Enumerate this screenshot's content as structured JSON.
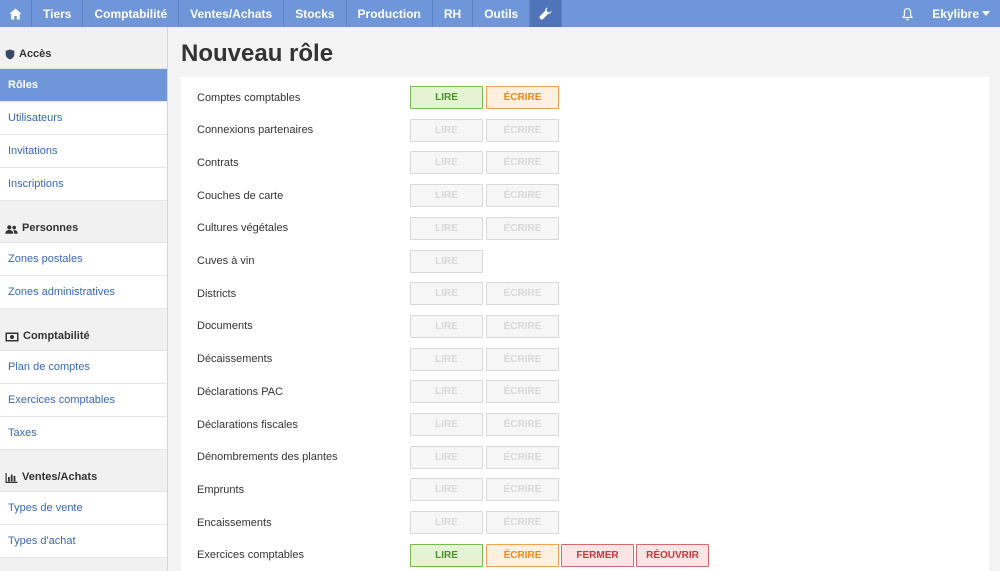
{
  "topbar": {
    "home_icon": "home-icon",
    "items": [
      "Tiers",
      "Comptabilité",
      "Ventes/Achats",
      "Stocks",
      "Production",
      "RH",
      "Outils"
    ],
    "settings_icon": "wrench-icon",
    "bell_icon": "bell-icon",
    "user": "Ekylibre"
  },
  "colors": {
    "accent": "#6f96d8",
    "read": "#77bb4a",
    "write": "#f0a24c",
    "danger": "#d66a6a"
  },
  "sidebar": {
    "sections": [
      {
        "title": "Accès",
        "icon": "shield-icon",
        "items": [
          {
            "label": "Rôles",
            "active": true
          },
          {
            "label": "Utilisateurs"
          },
          {
            "label": "Invitations"
          },
          {
            "label": "Inscriptions"
          }
        ]
      },
      {
        "title": "Personnes",
        "icon": "people-icon",
        "items": [
          {
            "label": "Zones postales"
          },
          {
            "label": "Zones administratives"
          }
        ]
      },
      {
        "title": "Comptabilité",
        "icon": "money-icon",
        "items": [
          {
            "label": "Plan de comptes"
          },
          {
            "label": "Exercices comptables"
          },
          {
            "label": "Taxes"
          }
        ]
      },
      {
        "title": "Ventes/Achats",
        "icon": "bar-chart-icon",
        "items": [
          {
            "label": "Types de vente"
          },
          {
            "label": "Types d'achat"
          }
        ]
      }
    ]
  },
  "main": {
    "title": "Nouveau rôle",
    "labels": {
      "read": "LIRE",
      "write": "ÉCRIRE",
      "close": "FERMER",
      "reopen": "RÉOUVRIR"
    },
    "rows": [
      {
        "label": "Comptes comptables",
        "read": true,
        "write": true
      },
      {
        "label": "Connexions partenaires"
      },
      {
        "label": "Contrats"
      },
      {
        "label": "Couches de carte"
      },
      {
        "label": "Cultures végétales"
      },
      {
        "label": "Cuves à vin",
        "read_only": true
      },
      {
        "label": "Districts"
      },
      {
        "label": "Documents"
      },
      {
        "label": "Décaissements"
      },
      {
        "label": "Déclarations PAC"
      },
      {
        "label": "Déclarations fiscales"
      },
      {
        "label": "Dénombrements des plantes"
      },
      {
        "label": "Emprunts"
      },
      {
        "label": "Encaissements"
      },
      {
        "label": "Exercices comptables",
        "read": true,
        "write": true,
        "close": true,
        "reopen": true
      }
    ]
  }
}
